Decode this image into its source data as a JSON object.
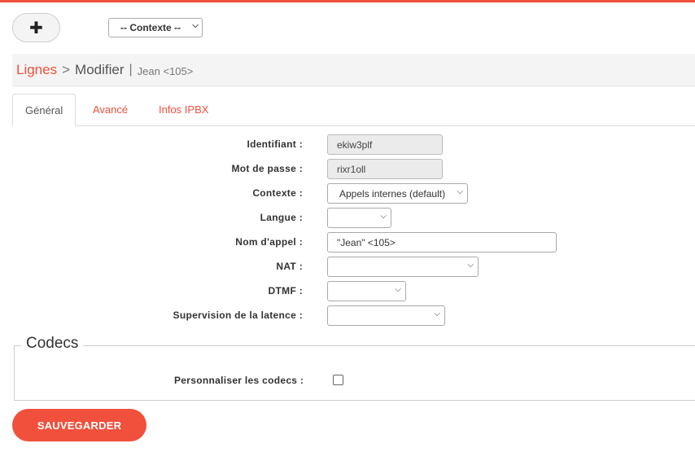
{
  "header": {
    "add_icon": "plus-icon",
    "add_symbol": "✚",
    "context_select": {
      "value": "-- Contexte --"
    }
  },
  "breadcrumb": {
    "section": "Lignes",
    "separator": ">",
    "current": "Modifier",
    "pipe": "|",
    "subject": "Jean <105>"
  },
  "tabs": [
    {
      "label": "Général",
      "active": true
    },
    {
      "label": "Avancé",
      "active": false
    },
    {
      "label": "Infos IPBX",
      "active": false
    }
  ],
  "form": {
    "identifiant": {
      "label": "Identifiant :",
      "value": "ekiw3plf"
    },
    "mot_de_passe": {
      "label": "Mot de passe :",
      "value": "rixr1oll"
    },
    "contexte": {
      "label": "Contexte :",
      "value": "Appels internes (default)"
    },
    "langue": {
      "label": "Langue :",
      "value": ""
    },
    "nom_appel": {
      "label": "Nom d'appel :",
      "value": "\"Jean\" <105>"
    },
    "nat": {
      "label": "NAT :",
      "value": ""
    },
    "dtmf": {
      "label": "DTMF :",
      "value": ""
    },
    "supervision": {
      "label": "Supervision de la latence :",
      "value": ""
    }
  },
  "codecs": {
    "legend": "Codecs",
    "custom_label": "Personnaliser les codecs :",
    "custom_checked": false
  },
  "actions": {
    "save_label": "SAUVEGARDER"
  },
  "colors": {
    "accent": "#f0503c",
    "readonly_bg": "#ebebeb"
  }
}
